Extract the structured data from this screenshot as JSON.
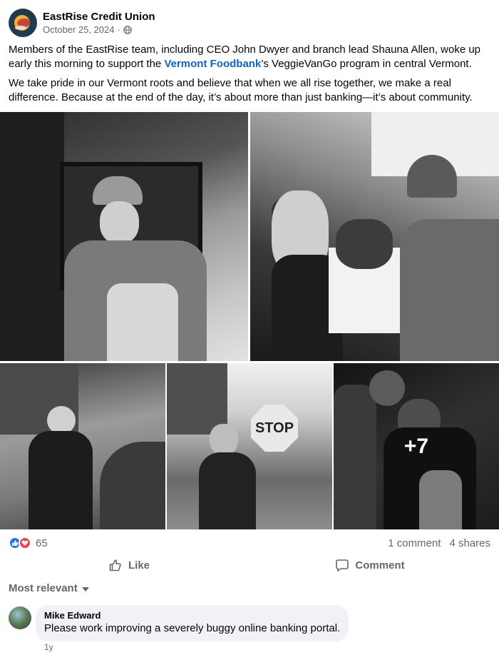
{
  "post": {
    "page_name": "EastRise Credit Union",
    "date": "October 25, 2024",
    "separator": "·",
    "paragraph1_before": "Members of the EastRise team, including CEO John Dwyer and branch lead Shauna Allen, woke up early this morning to support the ",
    "paragraph1_link": "Vermont Foodbank",
    "paragraph1_after": "’s VeggieVanGo program in central Vermont.",
    "paragraph2": "We take pride in our Vermont roots and believe that when we all rise together, we make a real difference. Because at the end of the day, it’s about more than just banking—it’s about community."
  },
  "photos": {
    "stop_sign_text": "STOP",
    "more_count": "+7"
  },
  "stats": {
    "reaction_count": "65",
    "comments": "1 comment",
    "shares": "4 shares"
  },
  "actions": {
    "like_label": "Like",
    "comment_label": "Comment"
  },
  "sort": {
    "label": "Most relevant"
  },
  "comment": {
    "author": "Mike Edward",
    "text": "Please work improving a severely buggy online banking portal.",
    "time": "1y"
  },
  "icons": [
    "globe-icon",
    "like-reaction-icon",
    "love-reaction-icon",
    "thumbs-up-icon",
    "comment-icon",
    "chevron-down-icon"
  ],
  "colors": {
    "link": "#0a66c2",
    "secondary_text": "#65676b",
    "like_blue": "#1877f2",
    "love_red": "#f33e58",
    "bubble_bg": "#f0f2f5"
  }
}
